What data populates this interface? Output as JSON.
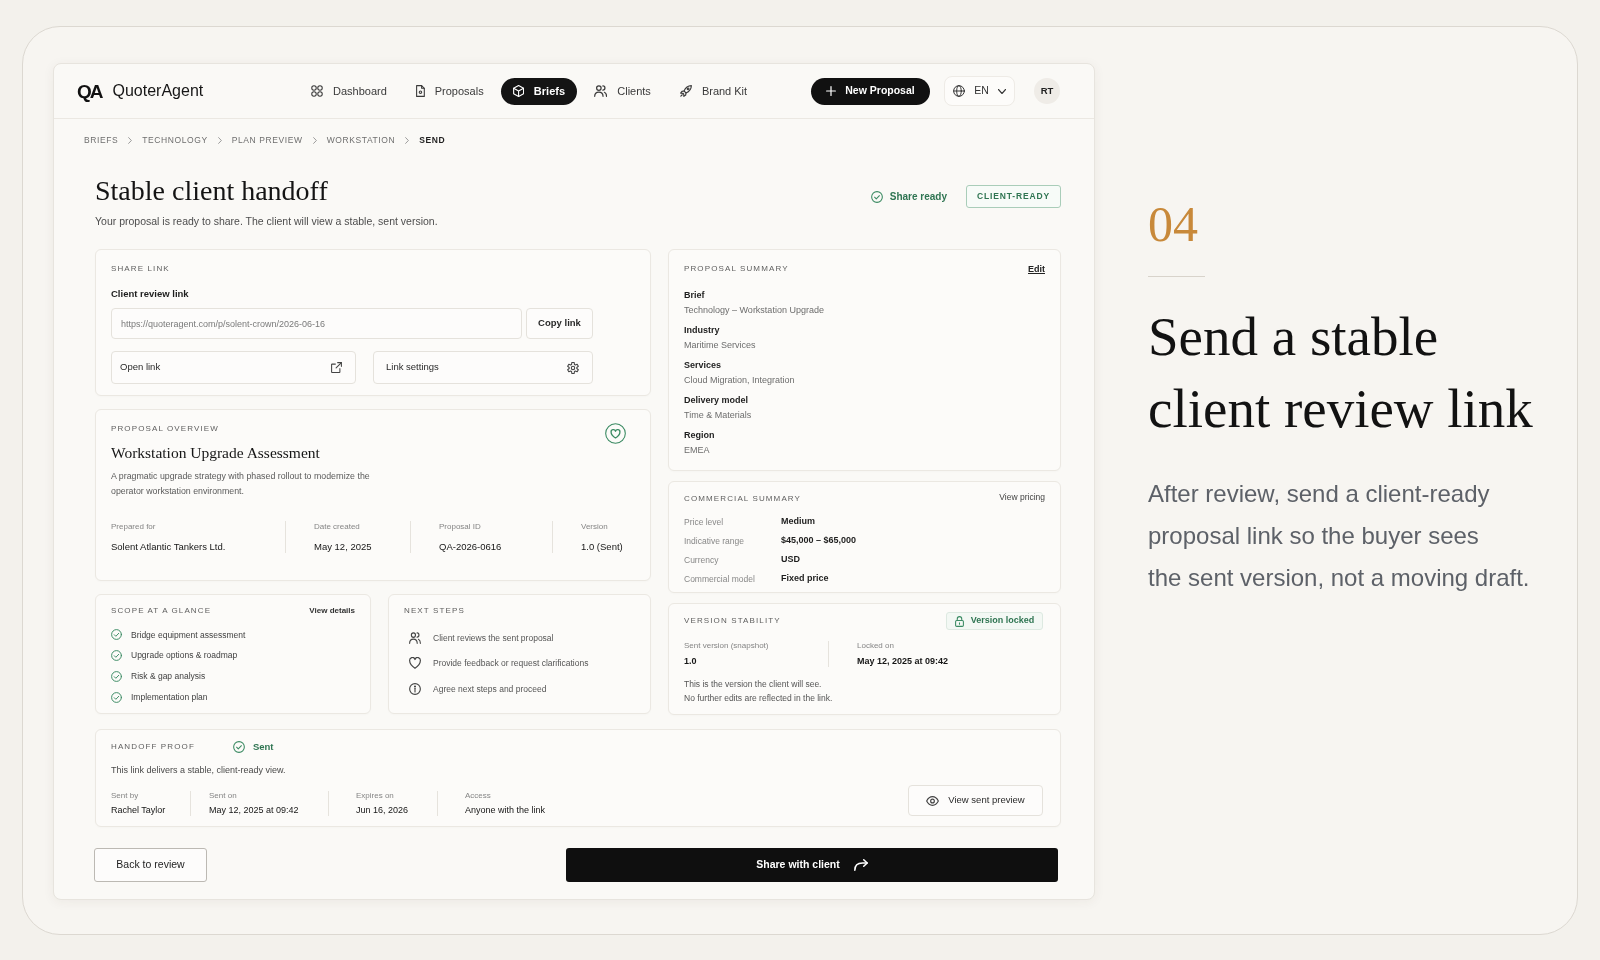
{
  "brand": {
    "mark": "QA",
    "name": "QuoterAgent"
  },
  "nav": [
    {
      "label": "Dashboard",
      "selected": false
    },
    {
      "label": "Proposals",
      "selected": false
    },
    {
      "label": "Briefs",
      "selected": true
    },
    {
      "label": "Clients",
      "selected": false
    },
    {
      "label": "Brand Kit",
      "selected": false
    }
  ],
  "new_button": "New Proposal",
  "language": "EN",
  "avatar": "RT",
  "breadcrumb": [
    {
      "label": "BRIEFS",
      "current": false
    },
    {
      "label": "TECHNOLOGY",
      "current": false
    },
    {
      "label": "PLAN PREVIEW",
      "current": false
    },
    {
      "label": "WORKSTATION",
      "current": false
    },
    {
      "label": "SEND",
      "current": true
    }
  ],
  "header": {
    "title": "Stable client handoff",
    "subtitle": "Your proposal is ready to share. The client will view a stable, sent version.",
    "status": "Share ready",
    "badge": "CLIENT-READY"
  },
  "share_link": {
    "section": "SHARE LINK",
    "field_label": "Client review link",
    "url": "https://quoteragent.com/p/solent-crown/2026-06-16",
    "copy_button": "Copy link",
    "open_button": "Open link",
    "settings_button": "Link settings"
  },
  "overview": {
    "section": "PROPOSAL OVERVIEW",
    "title": "Workstation Upgrade Assessment",
    "description": "A pragmatic upgrade strategy with phased rollout to modernize the operator workstation environment.",
    "meta": [
      {
        "label": "Prepared for",
        "value": "Solent Atlantic Tankers Ltd."
      },
      {
        "label": "Date created",
        "value": "May 12, 2025"
      },
      {
        "label": "Proposal ID",
        "value": "QA-2026-0616"
      },
      {
        "label": "Version",
        "value": "1.0 (Sent)"
      }
    ]
  },
  "scope": {
    "section": "SCOPE AT A GLANCE",
    "link": "View details",
    "items": [
      {
        "text": "Bridge equipment assessment",
        "checked": true
      },
      {
        "text": "Upgrade options & roadmap",
        "checked": true
      },
      {
        "text": "Risk & gap analysis",
        "checked": true
      },
      {
        "text": "Implementation plan",
        "checked": true
      }
    ]
  },
  "next_steps": {
    "section": "NEXT STEPS",
    "items": [
      "Client reviews the sent proposal",
      "Provide feedback or request clarifications",
      "Agree next steps and proceed"
    ]
  },
  "handoff": {
    "section": "HANDOFF PROOF",
    "status": "Sent",
    "text": "This link delivers a stable, client-ready view.",
    "meta": [
      {
        "label": "Sent by",
        "value": "Rachel Taylor"
      },
      {
        "label": "Sent on",
        "value": "May 12, 2025 at 09:42"
      },
      {
        "label": "Expires on",
        "value": "Jun 16, 2026"
      },
      {
        "label": "Access",
        "value": "Anyone with the link"
      }
    ],
    "preview_button": "View sent preview"
  },
  "summary": {
    "section": "PROPOSAL SUMMARY",
    "edit": "Edit",
    "fields": [
      {
        "label": "Brief",
        "value": "Technology – Workstation Upgrade"
      },
      {
        "label": "Industry",
        "value": "Maritime Services"
      },
      {
        "label": "Services",
        "value": "Cloud Migration, Integration"
      },
      {
        "label": "Delivery model",
        "value": "Time & Materials"
      },
      {
        "label": "Region",
        "value": "EMEA"
      }
    ]
  },
  "commercial": {
    "section": "COMMERCIAL SUMMARY",
    "link": "View pricing",
    "rows": [
      {
        "label": "Price level",
        "value": "Medium"
      },
      {
        "label": "Indicative range",
        "value": "$45,000 – $65,000"
      },
      {
        "label": "Currency",
        "value": "USD"
      },
      {
        "label": "Commercial model",
        "value": "Fixed price"
      }
    ]
  },
  "version": {
    "section": "VERSION STABILITY",
    "badge": "Version locked",
    "meta": [
      {
        "label": "Sent version (snapshot)",
        "value": "1.0"
      },
      {
        "label": "Locked on",
        "value": "May 12, 2025 at 09:42"
      }
    ],
    "notes": [
      "This is the version the client will see.",
      "No further edits are reflected in the link."
    ]
  },
  "actions": {
    "back": "Back to review",
    "share": "Share with client"
  },
  "feature": {
    "number": "04",
    "heading": "Send a stable client review link",
    "body_lines": [
      "After review, send a client-ready",
      "proposal link so the buyer sees",
      "the sent version, not a moving draft."
    ]
  }
}
